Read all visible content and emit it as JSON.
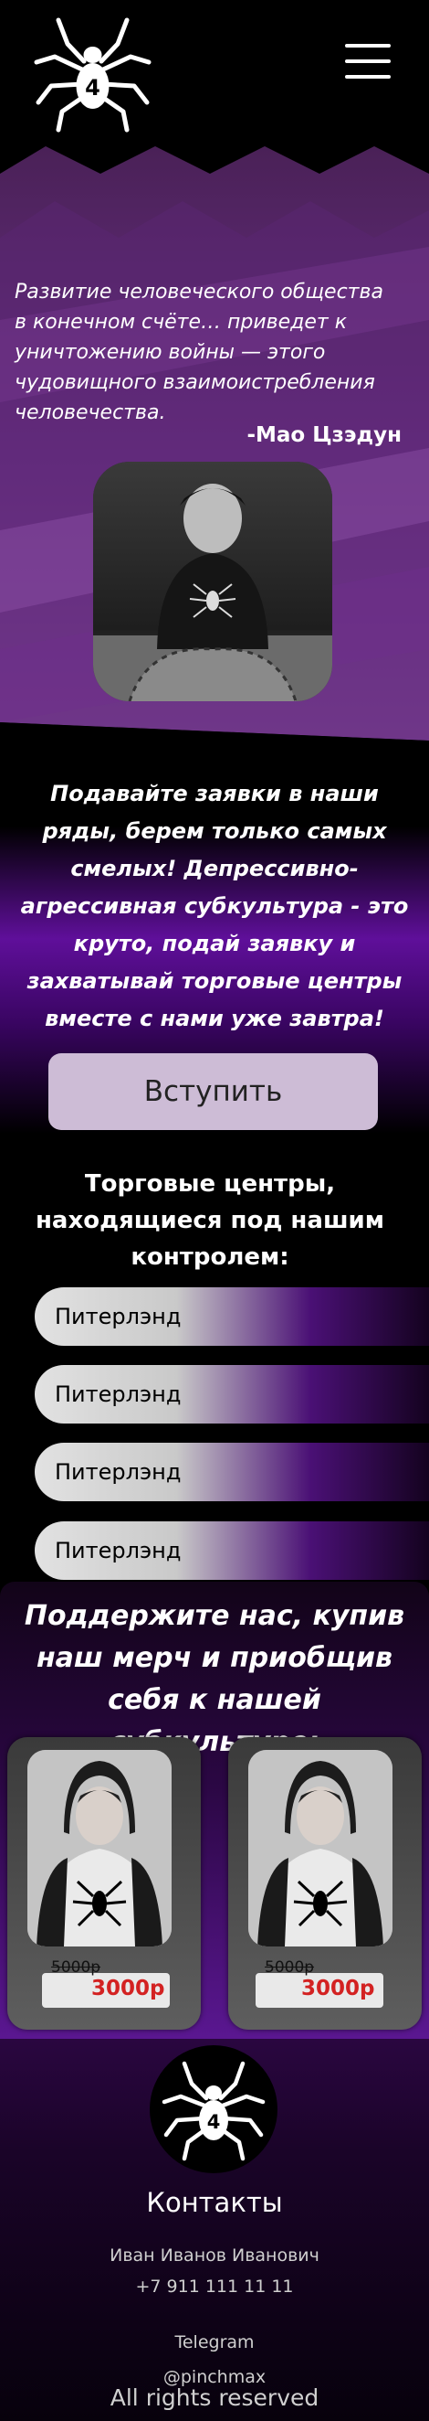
{
  "header": {
    "logo_number": "4"
  },
  "hero": {
    "quote": "Развитие человеческого общества в конечном счёте… приведет к уничтожению войны — этого чудовищного взаимоистребления человечества.",
    "author": "-Мао Цзэдун"
  },
  "cta": {
    "text": "Подавайте заявки в наши ряды, берем только самых смелых! Депрессивно-агрессивная субкультура - это круто, подай заявку и захватывай торговые центры вместе с нами уже завтра!",
    "button_label": "Вступить"
  },
  "malls": {
    "title": "Торговые центры, находящиеся под нашим контролем:",
    "items": [
      "Питерлэнд",
      "Питерлэнд",
      "Питерлэнд",
      "Питерлэнд"
    ]
  },
  "merch": {
    "title": "Поддержите нас, купив наш мерч и приобщив себя к нашей субкультуре:",
    "items": [
      {
        "old_price": "5000р",
        "price": "3000р"
      },
      {
        "old_price": "5000р",
        "price": "3000р"
      }
    ]
  },
  "footer": {
    "logo_number": "4",
    "contacts_title": "Контакты",
    "name": "Иван Иванов Иванович",
    "phone": "+7 911 111 11 11",
    "telegram_label": "Telegram",
    "telegram_handle": "@pinchmax",
    "rights": "All rights reserved"
  },
  "colors": {
    "accent_purple": "#5f0f9a",
    "button_bg": "#cdbcd6",
    "price_red": "#d32222"
  },
  "icons": {
    "logo": "spider-icon",
    "menu": "hamburger-menu-icon"
  }
}
